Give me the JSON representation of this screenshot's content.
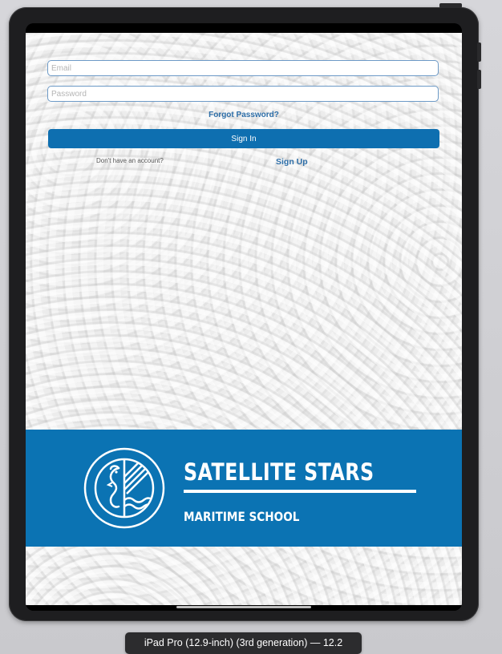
{
  "login": {
    "email_placeholder": "Email",
    "password_placeholder": "Password",
    "forgot_password": "Forgot Password?",
    "sign_in": "Sign In",
    "no_account": "Don't have an account?",
    "sign_up": "Sign Up"
  },
  "banner": {
    "title": "SATELLITE STARS",
    "subtitle": "MARITIME SCHOOL",
    "logo_icon": "seahorse-waves-emblem-icon",
    "background_color": "#0b73b3"
  },
  "simulator": {
    "device_label": "iPad Pro (12.9-inch) (3rd generation) — 12.2"
  },
  "colors": {
    "accent": "#0e6fb0",
    "link": "#2d6ea8",
    "field_border": "#6d9ac7"
  }
}
